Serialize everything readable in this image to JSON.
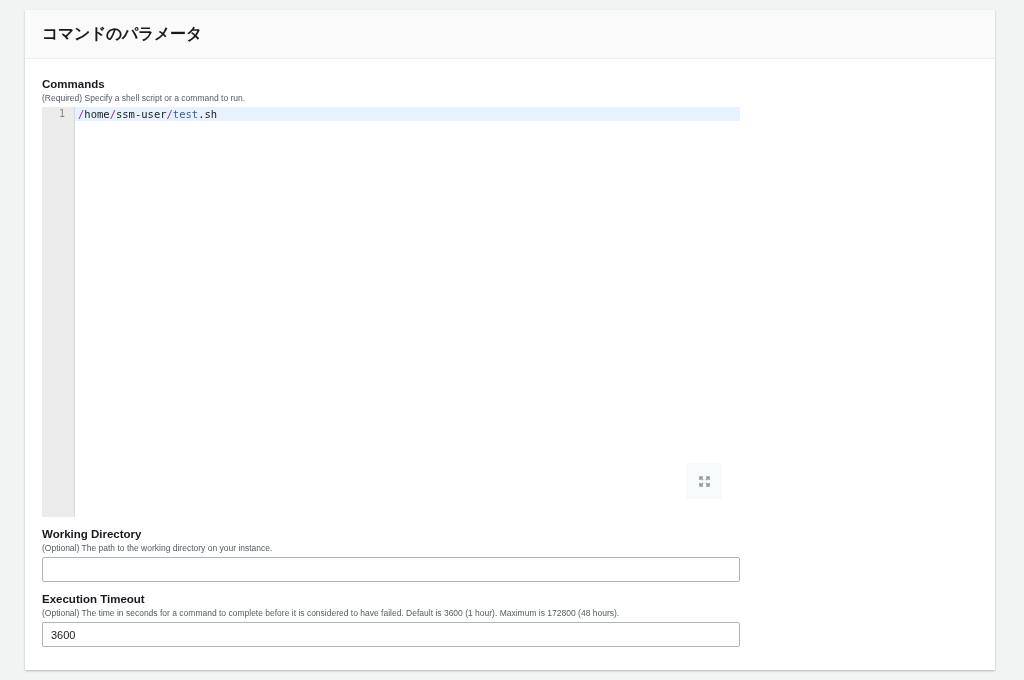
{
  "panel": {
    "title": "コマンドのパラメータ"
  },
  "commands": {
    "label": "Commands",
    "description": "(Required) Specify a shell script or a command to run.",
    "lines": [
      {
        "number": "1",
        "active": true,
        "tokens": [
          {
            "text": "/",
            "kind": "operator"
          },
          {
            "text": "home",
            "kind": "plain"
          },
          {
            "text": "/",
            "kind": "operator"
          },
          {
            "text": "ssm-user",
            "kind": "plain"
          },
          {
            "text": "/",
            "kind": "operator"
          },
          {
            "text": "test",
            "kind": "variable"
          },
          {
            "text": ".sh",
            "kind": "plain"
          }
        ]
      }
    ]
  },
  "working_directory": {
    "label": "Working Directory",
    "description": "(Optional) The path to the working directory on your instance."
  },
  "execution_timeout": {
    "label": "Execution Timeout",
    "description": "(Optional) The time in seconds for a command to complete before it is considered to have failed. Default is 3600 (1 hour). Maximum is 172800 (48 hours).",
    "value": "3600"
  }
}
